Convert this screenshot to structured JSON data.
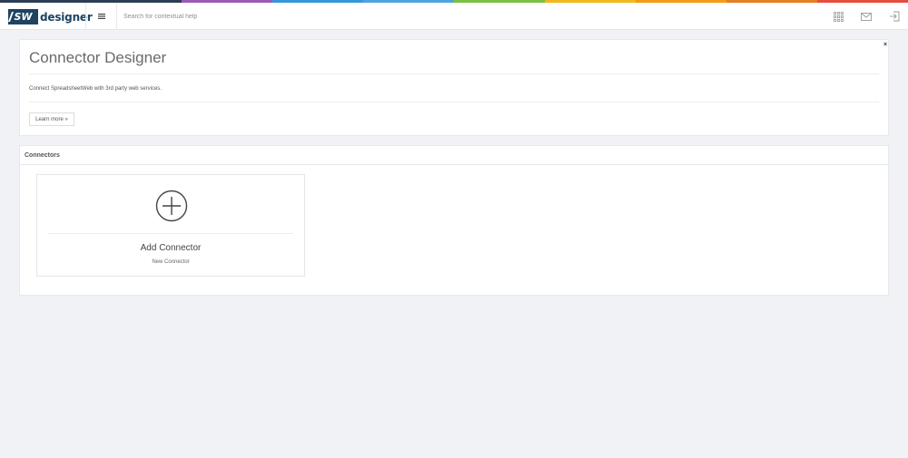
{
  "top_strip_colors": [
    "#2a3f54",
    "#2a3f54",
    "#9b59b6",
    "#3498db",
    "#4fa3e0",
    "#7ac143",
    "#f1b81c",
    "#f39c12",
    "#e67e22",
    "#e74c3c"
  ],
  "brand": {
    "badge": "SW",
    "name": "designer",
    "color": "#1e4461"
  },
  "header": {
    "menu_icon": "hamburger-icon",
    "search_placeholder": "Search for contextual help",
    "right_icons": [
      "apps-grid-icon",
      "mail-icon",
      "logout-icon"
    ]
  },
  "intro": {
    "title": "Connector Designer",
    "description": "Connect SpreadsheetWeb with 3rd party web services.",
    "learn_more": "Learn more »",
    "close": "×"
  },
  "connectors": {
    "section_title": "Connectors",
    "add_card": {
      "icon": "plus-circle-icon",
      "title": "Add Connector",
      "subtitle": "New Connector"
    }
  }
}
